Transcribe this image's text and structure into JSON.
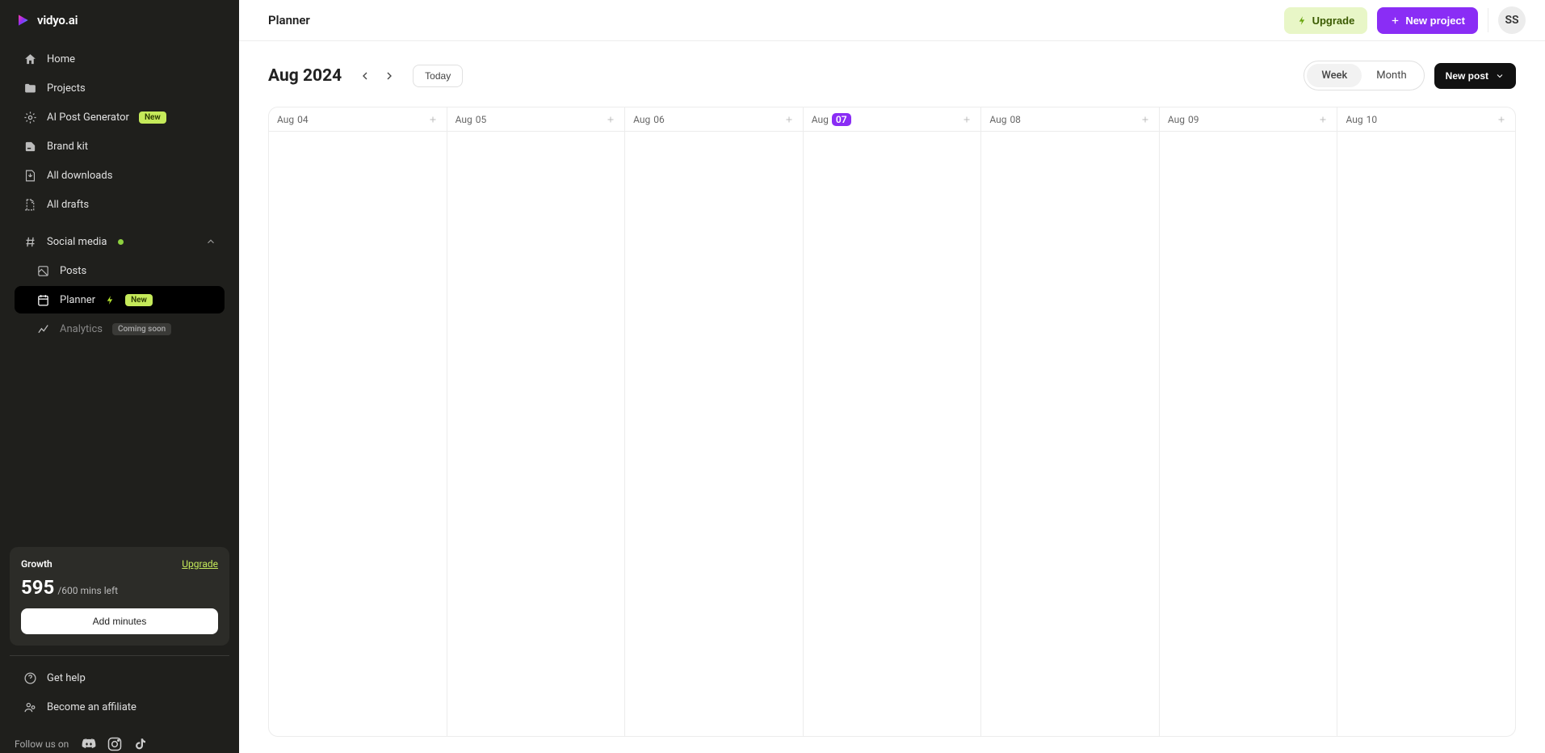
{
  "brand": {
    "name": "vidyo.ai"
  },
  "sidebar": {
    "items": {
      "home": "Home",
      "projects": "Projects",
      "ai_post": "AI Post Generator",
      "ai_post_badge": "New",
      "brand_kit": "Brand kit",
      "downloads": "All downloads",
      "drafts": "All drafts",
      "social": "Social media",
      "posts": "Posts",
      "planner": "Planner",
      "planner_badge": "New",
      "analytics": "Analytics",
      "analytics_badge": "Coming soon"
    },
    "usage": {
      "plan": "Growth",
      "upgrade": "Upgrade",
      "used": "595",
      "total": "/600 mins left",
      "add_btn": "Add minutes"
    },
    "footer": {
      "get_help": "Get help",
      "affiliate": "Become an affiliate",
      "follow": "Follow us on"
    }
  },
  "topbar": {
    "title": "Planner",
    "upgrade": "Upgrade",
    "new_project": "New project",
    "avatar": "SS"
  },
  "calendar": {
    "month": "Aug 2024",
    "today": "Today",
    "view_week": "Week",
    "view_month": "Month",
    "new_post": "New post",
    "days": [
      {
        "month": "Aug",
        "num": "04",
        "is_today": false
      },
      {
        "month": "Aug",
        "num": "05",
        "is_today": false
      },
      {
        "month": "Aug",
        "num": "06",
        "is_today": false
      },
      {
        "month": "Aug",
        "num": "07",
        "is_today": true
      },
      {
        "month": "Aug",
        "num": "08",
        "is_today": false
      },
      {
        "month": "Aug",
        "num": "09",
        "is_today": false
      },
      {
        "month": "Aug",
        "num": "10",
        "is_today": false
      }
    ]
  },
  "colors": {
    "accent": "#8a2df5",
    "lime": "#c5ea5a"
  }
}
